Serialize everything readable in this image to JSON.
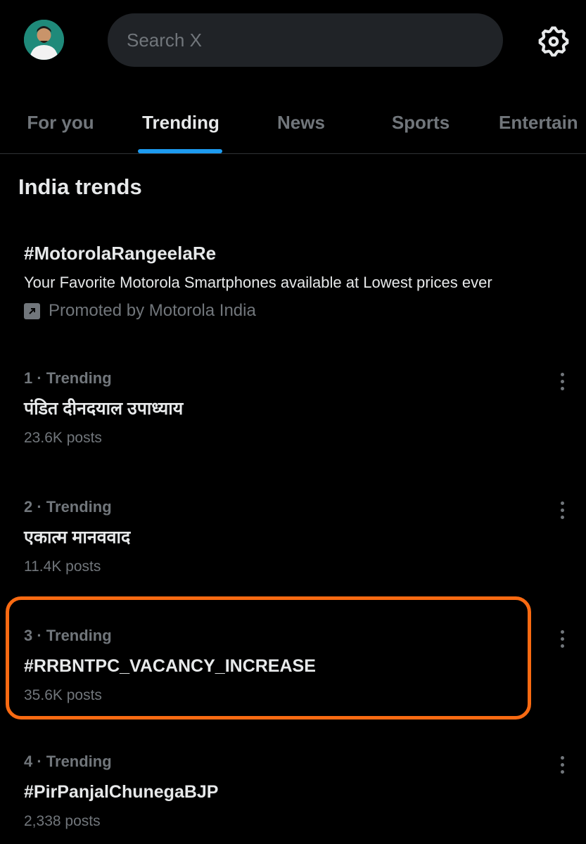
{
  "header": {
    "search": {
      "placeholder": "Search X"
    },
    "icons": {
      "avatar": "profile-avatar",
      "settings": "gear-icon"
    }
  },
  "tabs": [
    {
      "label": "For you",
      "active": false
    },
    {
      "label": "Trending",
      "active": true
    },
    {
      "label": "News",
      "active": false
    },
    {
      "label": "Sports",
      "active": false
    },
    {
      "label": "Entertain",
      "active": false
    }
  ],
  "section": {
    "title": "India trends"
  },
  "promoted": {
    "tag": "#MotorolaRangeelaRe",
    "description": "Your Favorite Motorola Smartphones available at Lowest prices ever",
    "promoted_by": "Promoted by Motorola India",
    "icon": "promoted-arrow-icon"
  },
  "trends": [
    {
      "meta": "1 · Trending",
      "name": "पंडित दीनदयाल उपाध्याय",
      "posts": "23.6K posts"
    },
    {
      "meta": "2 · Trending",
      "name": "एकात्म मानववाद",
      "posts": "11.4K posts"
    },
    {
      "meta": "3 · Trending",
      "name": "#RRBNTPC_VACANCY_INCREASE",
      "posts": "35.6K posts",
      "highlighted": true
    },
    {
      "meta": "4 · Trending",
      "name": "#PirPanjalChunegaBJP",
      "posts": "2,338 posts"
    }
  ],
  "colors": {
    "background": "#000000",
    "accent": "#1d9bf0",
    "muted_text": "#71767b",
    "highlight": "#f96a12"
  }
}
